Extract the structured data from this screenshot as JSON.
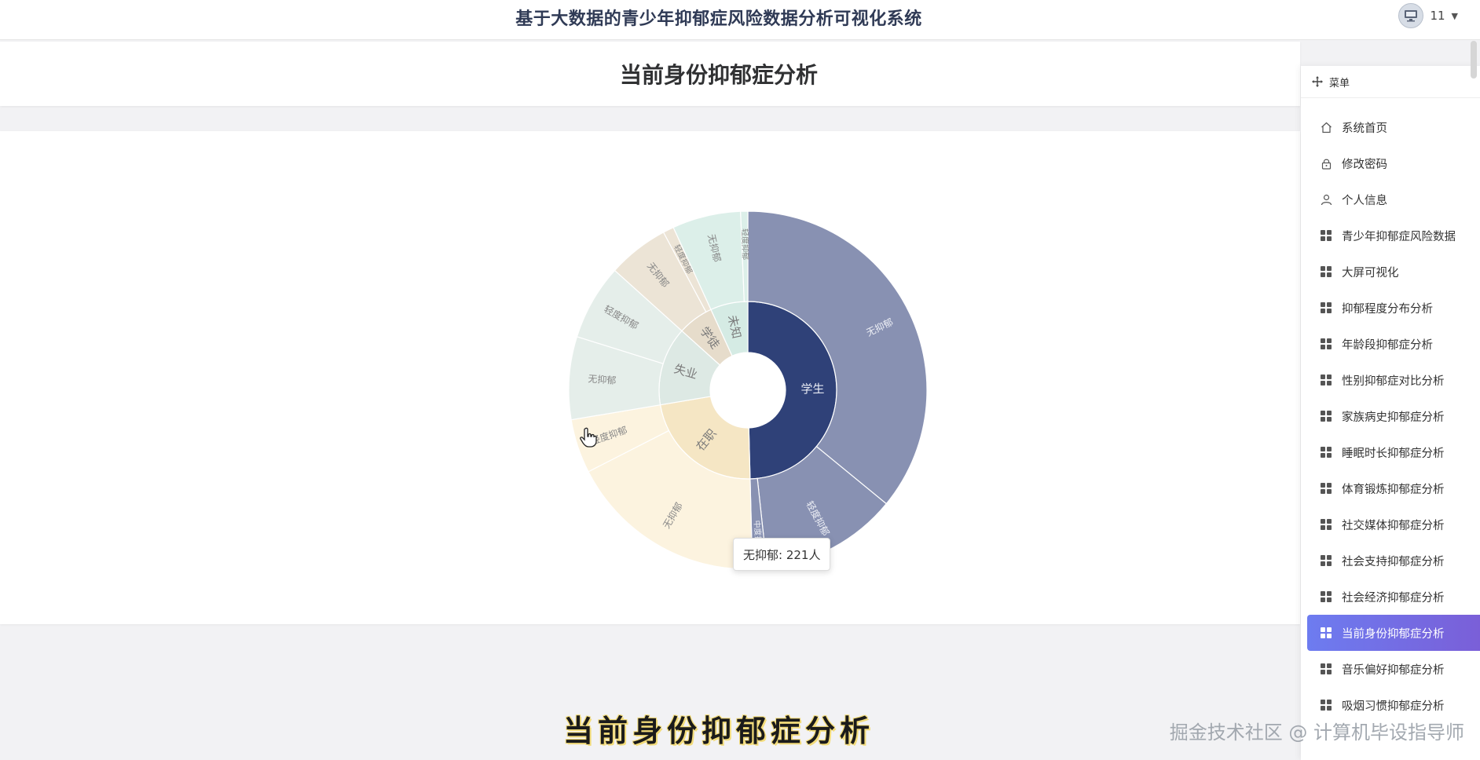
{
  "header": {
    "system_title": "基于大数据的青少年抑郁症风险数据分析可视化系统",
    "user_name": "11",
    "user_caret": "▼"
  },
  "page": {
    "title": "当前身份抑郁症分析"
  },
  "tooltip": {
    "text": "无抑郁: 221人"
  },
  "chart_data": {
    "type": "sunburst",
    "series": [
      {
        "name": "学生",
        "children": [
          {
            "name": "无抑郁",
            "value": 221
          },
          {
            "name": "轻度抑郁",
            "value": 76
          },
          {
            "name": "中度抑郁",
            "value": 8
          }
        ]
      },
      {
        "name": "在职",
        "children": [
          {
            "name": "无抑郁",
            "value": 110
          },
          {
            "name": "轻度抑郁",
            "value": 30
          }
        ]
      },
      {
        "name": "失业",
        "children": [
          {
            "name": "无抑郁",
            "value": 46
          },
          {
            "name": "轻度抑郁",
            "value": 42
          }
        ]
      },
      {
        "name": "学徒",
        "children": [
          {
            "name": "无抑郁",
            "value": 34
          },
          {
            "name": "轻度抑郁",
            "value": 6
          }
        ]
      },
      {
        "name": "未知",
        "children": [
          {
            "name": "无抑郁",
            "value": 38
          },
          {
            "name": "轻度抑郁",
            "value": 4
          }
        ]
      }
    ],
    "colors": {
      "学生": "#2f4178",
      "在职": "#f5e6c4",
      "失业": "#dde9e4",
      "学徒": "#e6dccb",
      "未知": "#d5ebe4"
    },
    "outer_colors": {
      "学生": "#8891b2",
      "在职": "#fcf3df",
      "失业": "#e5eeea",
      "学徒": "#ece4d6",
      "未知": "#dcefe9"
    },
    "label_color": "#888888"
  },
  "menu": {
    "header_label": "菜单",
    "items": [
      {
        "label": "系统首页",
        "icon": "home-icon"
      },
      {
        "label": "修改密码",
        "icon": "lock-icon"
      },
      {
        "label": "个人信息",
        "icon": "user-icon"
      },
      {
        "label": "青少年抑郁症风险数据",
        "icon": "grid-icon"
      },
      {
        "label": "大屏可视化",
        "icon": "grid-icon"
      },
      {
        "label": "抑郁程度分布分析",
        "icon": "grid-icon"
      },
      {
        "label": "年龄段抑郁症分析",
        "icon": "grid-icon"
      },
      {
        "label": "性别抑郁症对比分析",
        "icon": "grid-icon"
      },
      {
        "label": "家族病史抑郁症分析",
        "icon": "grid-icon"
      },
      {
        "label": "睡眠时长抑郁症分析",
        "icon": "grid-icon"
      },
      {
        "label": "体育锻炼抑郁症分析",
        "icon": "grid-icon"
      },
      {
        "label": "社交媒体抑郁症分析",
        "icon": "grid-icon"
      },
      {
        "label": "社会支持抑郁症分析",
        "icon": "grid-icon"
      },
      {
        "label": "社会经济抑郁症分析",
        "icon": "grid-icon"
      },
      {
        "label": "当前身份抑郁症分析",
        "icon": "grid-icon",
        "active": true
      },
      {
        "label": "音乐偏好抑郁症分析",
        "icon": "grid-icon"
      },
      {
        "label": "吸烟习惯抑郁症分析",
        "icon": "grid-icon"
      }
    ]
  },
  "overlay": {
    "subtitle": "当前身份抑郁症分析",
    "watermark": "掘金技术社区 @ 计算机毕设指导师"
  }
}
